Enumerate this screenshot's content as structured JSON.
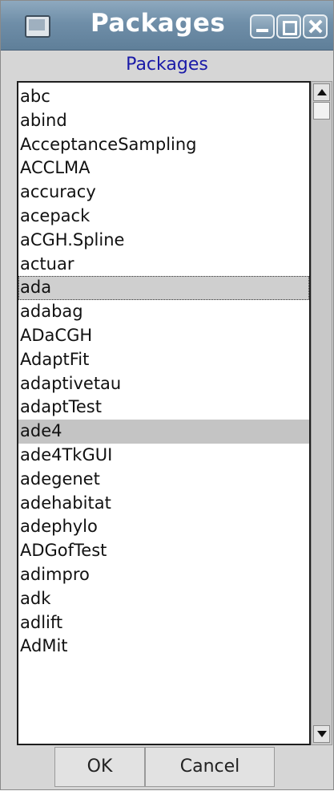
{
  "window": {
    "title": "Packages"
  },
  "heading": "Packages",
  "list": {
    "items": [
      "abc",
      "abind",
      "AcceptanceSampling",
      "ACCLMA",
      "accuracy",
      "acepack",
      "aCGH.Spline",
      "actuar",
      "ada",
      "adabag",
      "ADaCGH",
      "AdaptFit",
      "adaptivetau",
      "adaptTest",
      "ade4",
      "ade4TkGUI",
      "adegenet",
      "adehabitat",
      "adephylo",
      "ADGofTest",
      "adimpro",
      "adk",
      "adlift",
      "AdMit"
    ],
    "active_item": "ada",
    "selected_item": "ade4"
  },
  "buttons": {
    "ok_label": "OK",
    "cancel_label": "Cancel"
  },
  "icons": {
    "app": "window-app-icon",
    "minimize": "minimize-icon",
    "maximize": "maximize-icon",
    "close": "close-icon",
    "scroll_up": "arrow-up-icon",
    "scroll_down": "arrow-down-icon"
  },
  "colors": {
    "titlebar": "#6f8ea8",
    "heading_text": "#1a1aa8",
    "selection": "#c4c4c4"
  }
}
